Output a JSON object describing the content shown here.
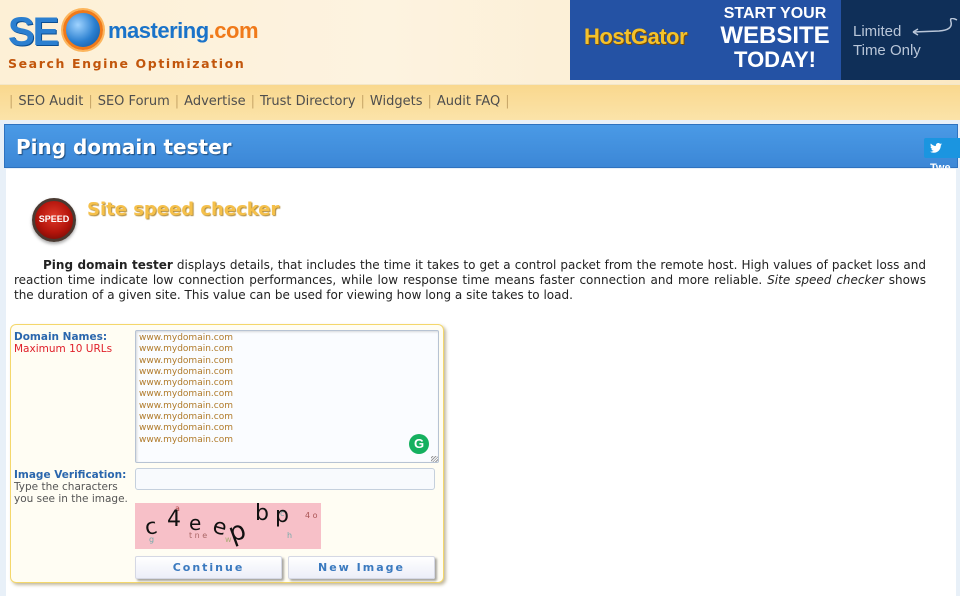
{
  "header": {
    "logo": {
      "prefix": "SE",
      "name": "mastering",
      "tld": ".com",
      "tagline": "Search Engine Optimization"
    },
    "ad": {
      "brand": "HostGator",
      "headline": [
        "START YOUR",
        "WEBSITE",
        "TODAY!"
      ],
      "offer": [
        "Limited",
        "Time Only"
      ],
      "colors": {
        "background": "#2452a4",
        "dark_panel": "#0f2f58",
        "brand": "#f4c22b"
      }
    }
  },
  "nav": {
    "items": [
      {
        "label": "SEO Audit"
      },
      {
        "label": "SEO Forum"
      },
      {
        "label": "Advertise"
      },
      {
        "label": "Trust Directory"
      },
      {
        "label": "Widgets"
      },
      {
        "label": "Audit FAQ"
      }
    ]
  },
  "page": {
    "title": "Ping domain tester",
    "tweet_label": "Twe",
    "tool_icon_label": "SPEED",
    "tool_heading": "Site speed checker",
    "description": {
      "bold_lead": "Ping domain tester",
      "part1": " displays details, that includes the time it takes to get a control packet from the remote host. High values of packet loss and reaction time indicate low connection performances, while low response time means faster connection and more reliable. ",
      "italic": "Site speed checker",
      "part2": " shows the duration of a given site. This value can be used for viewing how long a site takes to load."
    }
  },
  "form": {
    "domains_label": "Domain Names:",
    "domains_hint": "Maximum 10 URLs",
    "domains_values": [
      "www.mydomain.com",
      "www.mydomain.com",
      "www.mydomain.com",
      "www.mydomain.com",
      "www.mydomain.com",
      "www.mydomain.com",
      "www.mydomain.com",
      "www.mydomain.com",
      "www.mydomain.com",
      "www.mydomain.com"
    ],
    "verification_label": "Image Verification:",
    "verification_hint_1": "Type the characters",
    "verification_hint_2": "you see in the image.",
    "verification_value": "",
    "captcha_text": [
      "c",
      "4",
      "e",
      "e",
      "p",
      "b",
      "p"
    ],
    "continue_label": "Continue",
    "new_image_label": "New Image",
    "grammarly_icon": "G"
  },
  "colors": {
    "title_bar": "#3c87d6",
    "nav_bg": "#f9d88e",
    "label_blue": "#2a66ad",
    "hint_red": "#e0202a",
    "heading_gold": "#f5c04a"
  }
}
